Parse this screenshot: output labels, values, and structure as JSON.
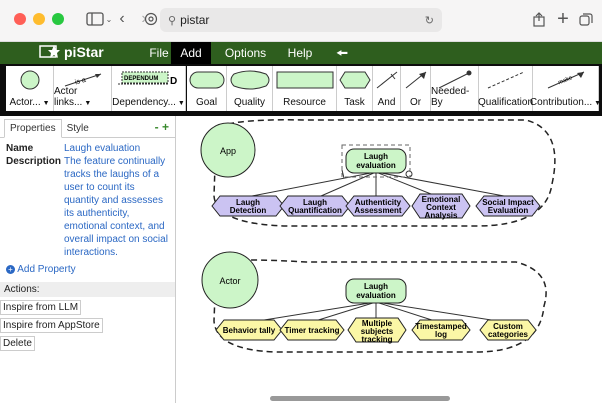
{
  "browser": {
    "url_text": "pistar"
  },
  "app": {
    "name": "piStar",
    "menu": [
      "File",
      "Add",
      "Options",
      "Help"
    ],
    "active_menu": "Add"
  },
  "toolbar": {
    "actor_label": "Actor...",
    "actor_links_label": "Actor links...",
    "actor_links_icon_text": "is a",
    "dependency_label": "Dependency...",
    "dependency_icon_text": "DEPENDUM",
    "dependency_icon_letter": "D",
    "goal_label": "Goal",
    "quality_label": "Quality",
    "resource_label": "Resource",
    "task_label": "Task",
    "and_label": "And",
    "or_label": "Or",
    "needed_by_label": "Needed-By",
    "qualification_label": "Qualification",
    "contribution_label": "Contribution...",
    "contribution_icon_text": "make"
  },
  "panel": {
    "tabs": [
      "Properties",
      "Style"
    ],
    "tab_controls": "- +",
    "name_key": "Name",
    "name_value": "Laugh evaluation",
    "description_key": "Description",
    "description_value": "The feature continually tracks the laughs of a user to count its quantity and assesses its authenticity, emotional context, and overall impact on social interactions.",
    "add_property": "Add Property",
    "actions_header": "Actions:",
    "actions": [
      "Inspire from LLM",
      "Inspire from AppStore",
      "Delete"
    ]
  },
  "diagram": {
    "actor1": {
      "name": "App",
      "root": [
        "Laugh",
        "evaluation"
      ],
      "tasks": [
        [
          "Laugh",
          "Detection"
        ],
        [
          "Laugh",
          "Quantification"
        ],
        [
          "Authenticity",
          "Assessment"
        ],
        [
          "Emotional",
          "Context",
          "Analysis"
        ],
        [
          "Social Impact",
          "Evaluation"
        ]
      ]
    },
    "actor2": {
      "name": "Actor",
      "root": [
        "Laugh",
        "evaluation"
      ],
      "tasks": [
        [
          "Behavior tally"
        ],
        [
          "Timer tracking"
        ],
        [
          "Multiple",
          "subjects",
          "tracking"
        ],
        [
          "Timestamped",
          "log"
        ],
        [
          "Custom",
          "categories"
        ]
      ]
    },
    "colors": {
      "goal_fill": "#ccf5c8",
      "task_fill_app": "#cbc3f2",
      "task_fill_actor": "#fbf7a6",
      "menu_bg": "#2e5e1e"
    }
  }
}
